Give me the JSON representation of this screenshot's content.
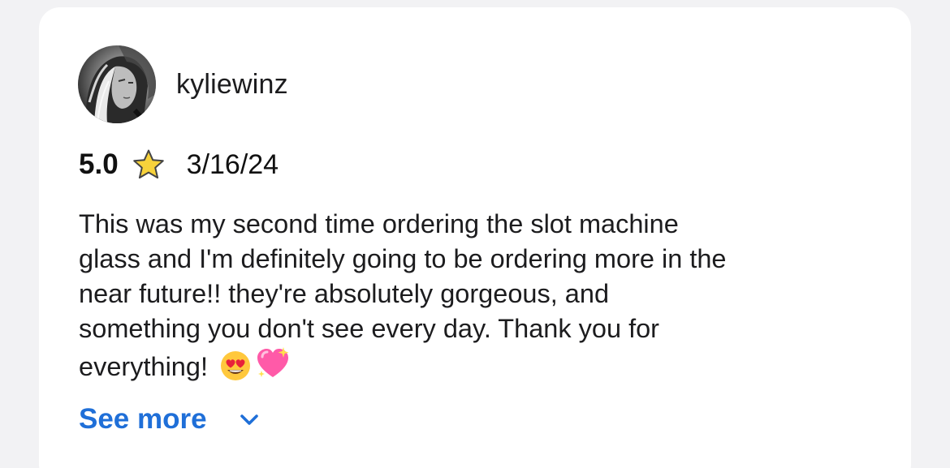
{
  "review": {
    "username": "kyliewinz",
    "rating": "5.0",
    "rating_icon": "star-icon",
    "date": "3/16/24",
    "body_lines": [
      "This was my second time ordering the slot machine",
      "glass and I'm definitely going to be ordering more in the",
      "near future!! they're absolutely gorgeous, and",
      "something you don't see every day. Thank you for",
      "everything!"
    ],
    "emojis": [
      "heart-eyes-face-icon",
      "sparkling-heart-icon"
    ],
    "see_more_label": "See more",
    "see_more_icon": "chevron-down-icon"
  },
  "colors": {
    "link": "#1f6fd8",
    "card": "#ffffff",
    "background": "#f2f2f4",
    "star": "#f7d23b"
  }
}
